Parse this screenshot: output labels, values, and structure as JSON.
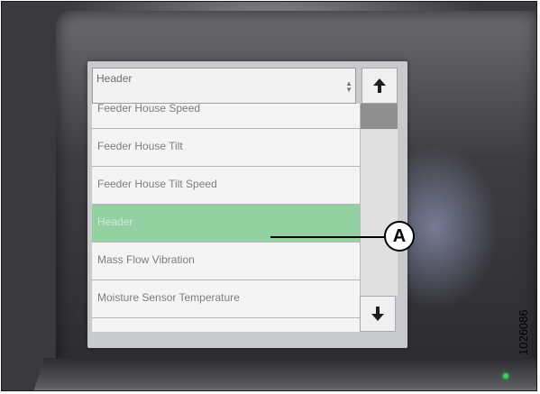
{
  "dropdown": {
    "selected_value": "Header"
  },
  "list": {
    "items": [
      {
        "label": "Feeder House Speed",
        "selected": false
      },
      {
        "label": "Feeder House Tilt",
        "selected": false
      },
      {
        "label": "Feeder House Tilt Speed",
        "selected": false
      },
      {
        "label": "Header",
        "selected": true
      },
      {
        "label": "Mass Flow Vibration",
        "selected": false
      },
      {
        "label": "Moisture Sensor Temperature",
        "selected": false
      }
    ]
  },
  "callout": {
    "label": "A"
  },
  "figure": {
    "number": "1026086"
  },
  "colors": {
    "selected_row": "#93d1a2",
    "status_led": "#3ad15c"
  },
  "icons": {
    "scroll_up": "arrow-up-icon",
    "scroll_down": "arrow-down-icon",
    "dropdown": "updown-arrows-icon"
  }
}
